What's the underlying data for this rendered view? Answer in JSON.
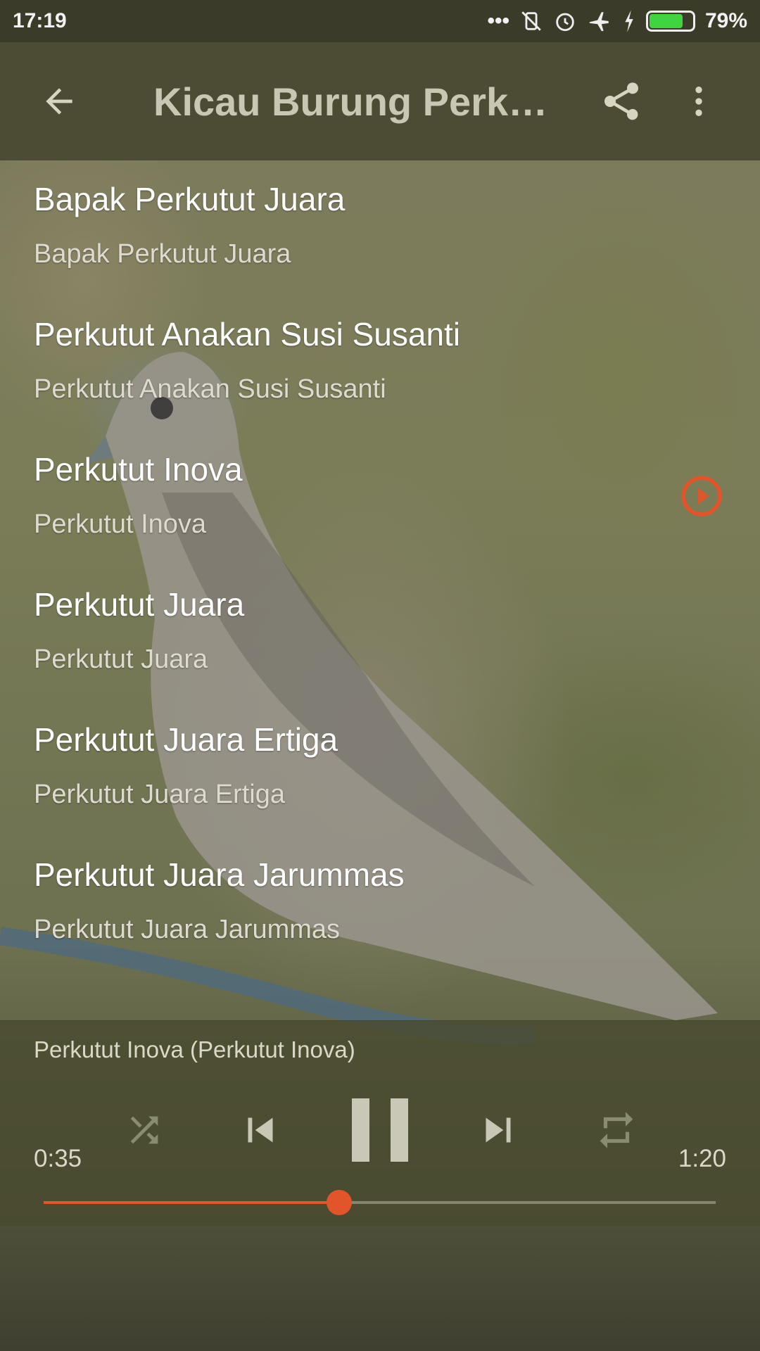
{
  "status_bar": {
    "time": "17:19",
    "battery_percent": "79%",
    "battery_level": 0.79,
    "icons": [
      "more-dots-icon",
      "vibrate-off-icon",
      "alarm-icon",
      "airplane-icon",
      "charging-icon",
      "battery-icon"
    ]
  },
  "toolbar": {
    "title": "Kicau Burung Perkutut Juara",
    "back_icon": "arrow-back-icon",
    "share_icon": "share-icon",
    "more_icon": "more-vertical-icon"
  },
  "tracks": [
    {
      "title": "Bapak Perkutut Juara",
      "subtitle": "Bapak Perkutut Juara"
    },
    {
      "title": "Perkutut Anakan Susi Susanti",
      "subtitle": "Perkutut Anakan Susi Susanti"
    },
    {
      "title": "Perkutut Inova",
      "subtitle": "Perkutut Inova",
      "playing": true
    },
    {
      "title": "Perkutut Juara",
      "subtitle": "Perkutut Juara"
    },
    {
      "title": "Perkutut Juara Ertiga",
      "subtitle": "Perkutut Juara Ertiga"
    },
    {
      "title": "Perkutut Juara Jarummas",
      "subtitle": "Perkutut Juara Jarummas"
    }
  ],
  "player": {
    "now_playing": "Perkutut Inova (Perkutut Inova)",
    "elapsed": "0:35",
    "duration": "1:20",
    "progress": 0.44,
    "accent_color": "#e2542a",
    "controls": [
      "shuffle-icon",
      "skip-previous-icon",
      "pause-icon",
      "skip-next-icon",
      "repeat-icon"
    ]
  }
}
